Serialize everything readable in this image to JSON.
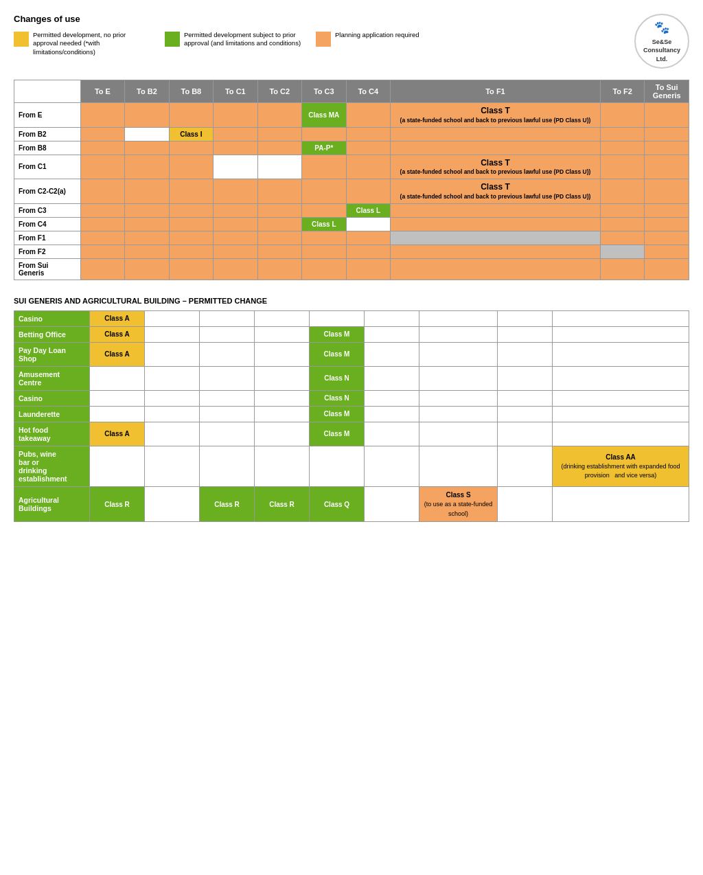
{
  "header": {
    "title": "Changes of use",
    "legend": [
      {
        "color": "#F0C030",
        "text": "Permitted development, no prior approval needed (*with limitations/conditions)"
      },
      {
        "color": "#6AAF20",
        "text": "Permitted development subject to prior approval (and limitations and conditions)"
      },
      {
        "color": "#F4A460",
        "text": "Planning application required"
      }
    ],
    "logo": {
      "line1": "Se&Se",
      "line2": "Consultancy",
      "line3": "Ltd."
    }
  },
  "main_table": {
    "columns": [
      "",
      "To E",
      "To B2",
      "To B8",
      "To C1",
      "To C2",
      "To C3",
      "To C4",
      "To F1",
      "To F2",
      "To Sui\nGeneris"
    ],
    "rows": [
      {
        "label": "From E",
        "cells": [
          "orange",
          "orange",
          "orange",
          "orange",
          "orange",
          "class-ma",
          "orange",
          "class-t",
          "orange",
          "orange"
        ]
      },
      {
        "label": "From B2",
        "cells": [
          "orange",
          "white",
          "class-i",
          "orange",
          "orange",
          "orange",
          "orange",
          "orange",
          "orange",
          "orange"
        ]
      },
      {
        "label": "From B8",
        "cells": [
          "orange",
          "orange",
          "orange",
          "orange",
          "orange",
          "pa-p",
          "orange",
          "orange",
          "orange",
          "orange"
        ]
      },
      {
        "label": "From C1",
        "cells": [
          "orange",
          "orange",
          "orange",
          "white",
          "white",
          "orange",
          "orange",
          "class-t2",
          "orange",
          "orange"
        ]
      },
      {
        "label": "From C2-C2(a)",
        "cells": [
          "orange",
          "orange",
          "orange",
          "orange",
          "orange",
          "orange",
          "orange",
          "class-t3",
          "orange",
          "orange"
        ]
      },
      {
        "label": "From C3",
        "cells": [
          "orange",
          "orange",
          "orange",
          "orange",
          "orange",
          "orange",
          "class-l",
          "orange",
          "orange",
          "orange"
        ]
      },
      {
        "label": "From C4",
        "cells": [
          "orange",
          "orange",
          "orange",
          "orange",
          "orange",
          "class-l2",
          "white",
          "orange",
          "orange",
          "orange"
        ]
      },
      {
        "label": "From F1",
        "cells": [
          "orange",
          "orange",
          "orange",
          "orange",
          "orange",
          "orange",
          "orange",
          "gray",
          "orange",
          "orange"
        ]
      },
      {
        "label": "From F2",
        "cells": [
          "orange",
          "orange",
          "orange",
          "orange",
          "orange",
          "orange",
          "orange",
          "orange",
          "gray",
          "orange"
        ]
      },
      {
        "label": "From Sui\nGeneris",
        "cells": [
          "orange",
          "orange",
          "orange",
          "orange",
          "orange",
          "orange",
          "orange",
          "orange",
          "orange",
          "orange"
        ]
      }
    ]
  },
  "class_labels": {
    "class_ma": "Class MA",
    "class_i": "Class I",
    "pa_p": "PA-P*",
    "class_t": "Class T",
    "class_t_desc": "(a state-funded school and back to previous lawful use (PD Class U))",
    "class_l": "Class L",
    "class_l2": "Class L"
  },
  "sui_section": {
    "title": "SUI GENERIS AND AGRICULTURAL BUILDING – PERMITTED CHANGE",
    "rows": [
      {
        "label": "Casino",
        "col1": "Class A",
        "col2": "",
        "col3": "",
        "col4": "",
        "col5": "",
        "col6": "",
        "col7": "",
        "col8": "",
        "col9": ""
      },
      {
        "label": "Betting Office",
        "col1": "Class A",
        "col2": "",
        "col3": "",
        "col4": "",
        "col5": "Class M",
        "col6": "",
        "col7": "",
        "col8": "",
        "col9": ""
      },
      {
        "label": "Pay Day Loan\nShop",
        "col1": "Class A",
        "col2": "",
        "col3": "",
        "col4": "",
        "col5": "Class M",
        "col6": "",
        "col7": "",
        "col8": "",
        "col9": ""
      },
      {
        "label": "Amusement\nCentre",
        "col1": "",
        "col2": "",
        "col3": "",
        "col4": "",
        "col5": "Class N",
        "col6": "",
        "col7": "",
        "col8": "",
        "col9": ""
      },
      {
        "label": "Casino",
        "col1": "",
        "col2": "",
        "col3": "",
        "col4": "",
        "col5": "Class N",
        "col6": "",
        "col7": "",
        "col8": "",
        "col9": ""
      },
      {
        "label": "Launderette",
        "col1": "",
        "col2": "",
        "col3": "",
        "col4": "",
        "col5": "Class M",
        "col6": "",
        "col7": "",
        "col8": "",
        "col9": ""
      },
      {
        "label": "Hot food\ntakeaway",
        "col1": "Class A",
        "col2": "",
        "col3": "",
        "col4": "",
        "col5": "Class M",
        "col6": "",
        "col7": "",
        "col8": "",
        "col9": ""
      },
      {
        "label": "Pubs, wine\nbar or\ndrinking\nestablishment",
        "col1": "",
        "col2": "",
        "col3": "",
        "col4": "",
        "col5": "",
        "col6": "",
        "col7": "",
        "col8": "",
        "col9": "Class AA\n(drinking establishment with expanded food provision and vice versa)"
      },
      {
        "label": "Agricultural\nBuildings",
        "col1": "Class R",
        "col2": "",
        "col3": "Class R",
        "col4": "Class R",
        "col5": "Class Q",
        "col6": "",
        "col7": "Class S\n(to use as a state-funded school)",
        "col8": "",
        "col9": ""
      }
    ]
  }
}
